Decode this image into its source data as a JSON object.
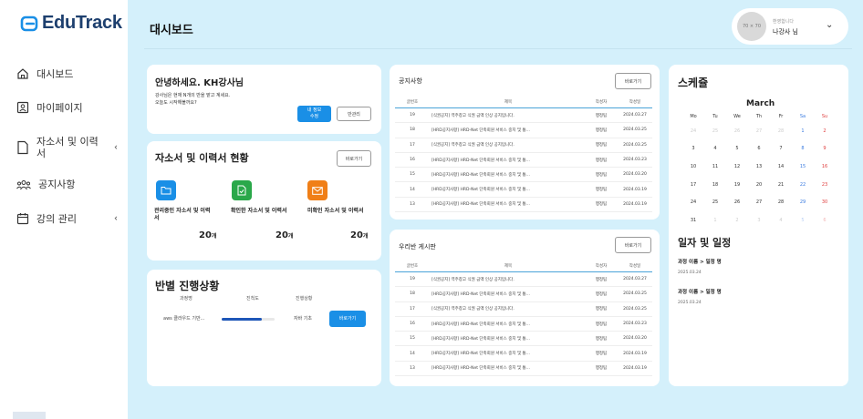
{
  "app": {
    "name": "EduTrack"
  },
  "sidebar": {
    "items": [
      {
        "label": "대시보드",
        "icon": "home-icon"
      },
      {
        "label": "마이페이지",
        "icon": "user-card-icon"
      },
      {
        "label": "자소서 및 이력서",
        "icon": "document-icon",
        "chevron": "‹"
      },
      {
        "label": "공지사항",
        "icon": "group-icon"
      },
      {
        "label": "강의 관리",
        "icon": "calendar-icon",
        "chevron": "‹"
      }
    ]
  },
  "header": {
    "title": "대시보드",
    "avatar_placeholder": "70 × 70",
    "greeting": "환영합니다",
    "user_name": "나강사 님",
    "chevron": "⌄"
  },
  "welcome": {
    "title": "안녕하세요. KH강사님",
    "line1": "강사님은 현재 N개의 반을 맡고 계세요.",
    "line2": "오늘도 시작해볼까요?",
    "primary_button": "내 정보 수정",
    "secondary_button": "반관리"
  },
  "resumes": {
    "title": "자소서 및 이력서 현황",
    "button": "바로가기",
    "items": [
      {
        "label": "관리중인 자소서 및 이력서",
        "count": "20",
        "unit": "개",
        "color": "#1a8fe6",
        "icon": "folder-icon"
      },
      {
        "label": "확인한 자소서 및 이력서",
        "count": "20",
        "unit": "개",
        "color": "#2aa84a",
        "icon": "file-check-icon"
      },
      {
        "label": "미확인 자소서 및 이력서",
        "count": "20",
        "unit": "개",
        "color": "#f07f17",
        "icon": "mail-icon"
      }
    ]
  },
  "progress": {
    "title": "반별 진행상황",
    "headers": [
      "과정명",
      "진척도",
      "진행상황"
    ],
    "rows": [
      {
        "course": "aws 클라우드 기반...",
        "progress": 0.75,
        "status": "자바 기초",
        "button": "바로가기"
      }
    ]
  },
  "notices": {
    "title": "공지사항",
    "button": "바로가기",
    "headers": [
      "글번호",
      "제목",
      "작성자",
      "작성일"
    ],
    "rows": [
      {
        "num": "19",
        "title": "[식권공지] 역주창고 식권 금액 인상 공지입니다.",
        "author": "행정팀",
        "date": "2024.03.27"
      },
      {
        "num": "18",
        "title": "[HRD공지사항] HRD-Net 단축회원 서비스 중지 및 통...",
        "author": "행정팀",
        "date": "2024.03.25"
      },
      {
        "num": "17",
        "title": "[식권공지] 역주창고 식권 금액 인상 공지입니다.",
        "author": "행정팀",
        "date": "2024.03.25"
      },
      {
        "num": "16",
        "title": "[HRD공지사항] HRD-Net 단축회원 서비스 중지 및 통...",
        "author": "행정팀",
        "date": "2024.03.23"
      },
      {
        "num": "15",
        "title": "[HRD공지사항] HRD-Net 단축회원 서비스 중지 및 통...",
        "author": "행정팀",
        "date": "2024.03.20"
      },
      {
        "num": "14",
        "title": "[HRD공지사항] HRD-Net 단축회원 서비스 중지 및 통...",
        "author": "행정팀",
        "date": "2024.03.19"
      },
      {
        "num": "13",
        "title": "[HRD공지사항] HRD-Net 단축회원 서비스 중지 및 통...",
        "author": "행정팀",
        "date": "2024.03.19"
      }
    ]
  },
  "classboard": {
    "title": "우리반 게시판",
    "button": "바로가기",
    "headers": [
      "글번호",
      "제목",
      "작성자",
      "작성일"
    ],
    "rows": [
      {
        "num": "19",
        "title": "[식권공지] 역주창고 식권 금액 인상 공지입니다.",
        "author": "행정팀",
        "date": "2024.03.27"
      },
      {
        "num": "18",
        "title": "[HRD공지사항] HRD-Net 단축회원 서비스 중지 및 통...",
        "author": "행정팀",
        "date": "2024.03.25"
      },
      {
        "num": "17",
        "title": "[식권공지] 역주창고 식권 금액 인상 공지입니다.",
        "author": "행정팀",
        "date": "2024.03.25"
      },
      {
        "num": "16",
        "title": "[HRD공지사항] HRD-Net 단축회원 서비스 중지 및 통...",
        "author": "행정팀",
        "date": "2024.03.23"
      },
      {
        "num": "15",
        "title": "[HRD공지사항] HRD-Net 단축회원 서비스 중지 및 통...",
        "author": "행정팀",
        "date": "2024.03.20"
      },
      {
        "num": "14",
        "title": "[HRD공지사항] HRD-Net 단축회원 서비스 중지 및 통...",
        "author": "행정팀",
        "date": "2024.03.19"
      },
      {
        "num": "13",
        "title": "[HRD공지사항] HRD-Net 단축회원 서비스 중지 및 통...",
        "author": "행정팀",
        "date": "2024.03.19"
      }
    ]
  },
  "schedule": {
    "title": "스케쥴",
    "month": "March",
    "weekdays": [
      "Mo",
      "Tu",
      "We",
      "Th",
      "Fr",
      "Sa",
      "Su"
    ],
    "weeks": [
      [
        {
          "d": "24",
          "o": true
        },
        {
          "d": "25",
          "o": true
        },
        {
          "d": "26",
          "o": true
        },
        {
          "d": "27",
          "o": true
        },
        {
          "d": "28",
          "o": true
        },
        {
          "d": "1"
        },
        {
          "d": "2"
        }
      ],
      [
        {
          "d": "3"
        },
        {
          "d": "4"
        },
        {
          "d": "5"
        },
        {
          "d": "6"
        },
        {
          "d": "7"
        },
        {
          "d": "8"
        },
        {
          "d": "9"
        }
      ],
      [
        {
          "d": "10"
        },
        {
          "d": "11"
        },
        {
          "d": "12"
        },
        {
          "d": "13"
        },
        {
          "d": "14"
        },
        {
          "d": "15"
        },
        {
          "d": "16"
        }
      ],
      [
        {
          "d": "17"
        },
        {
          "d": "18"
        },
        {
          "d": "19"
        },
        {
          "d": "20"
        },
        {
          "d": "21"
        },
        {
          "d": "22"
        },
        {
          "d": "23"
        }
      ],
      [
        {
          "d": "24"
        },
        {
          "d": "25"
        },
        {
          "d": "26"
        },
        {
          "d": "27"
        },
        {
          "d": "28"
        },
        {
          "d": "29"
        },
        {
          "d": "30"
        }
      ],
      [
        {
          "d": "31"
        },
        {
          "d": "1",
          "o": true
        },
        {
          "d": "2",
          "o": true
        },
        {
          "d": "3",
          "o": true
        },
        {
          "d": "4",
          "o": true
        },
        {
          "d": "5",
          "o": true
        },
        {
          "d": "6",
          "o": true
        }
      ]
    ],
    "events_title": "일자 및 일정",
    "events": [
      {
        "name": "과정 이름 > 일정 명",
        "date": "2025.03.24"
      },
      {
        "name": "과정 이름 > 일정 명",
        "date": "2025.03.24"
      }
    ]
  },
  "colors": {
    "primary": "#1a8fe6",
    "background": "#d4f0fb",
    "brand": "#1d3f6e"
  }
}
